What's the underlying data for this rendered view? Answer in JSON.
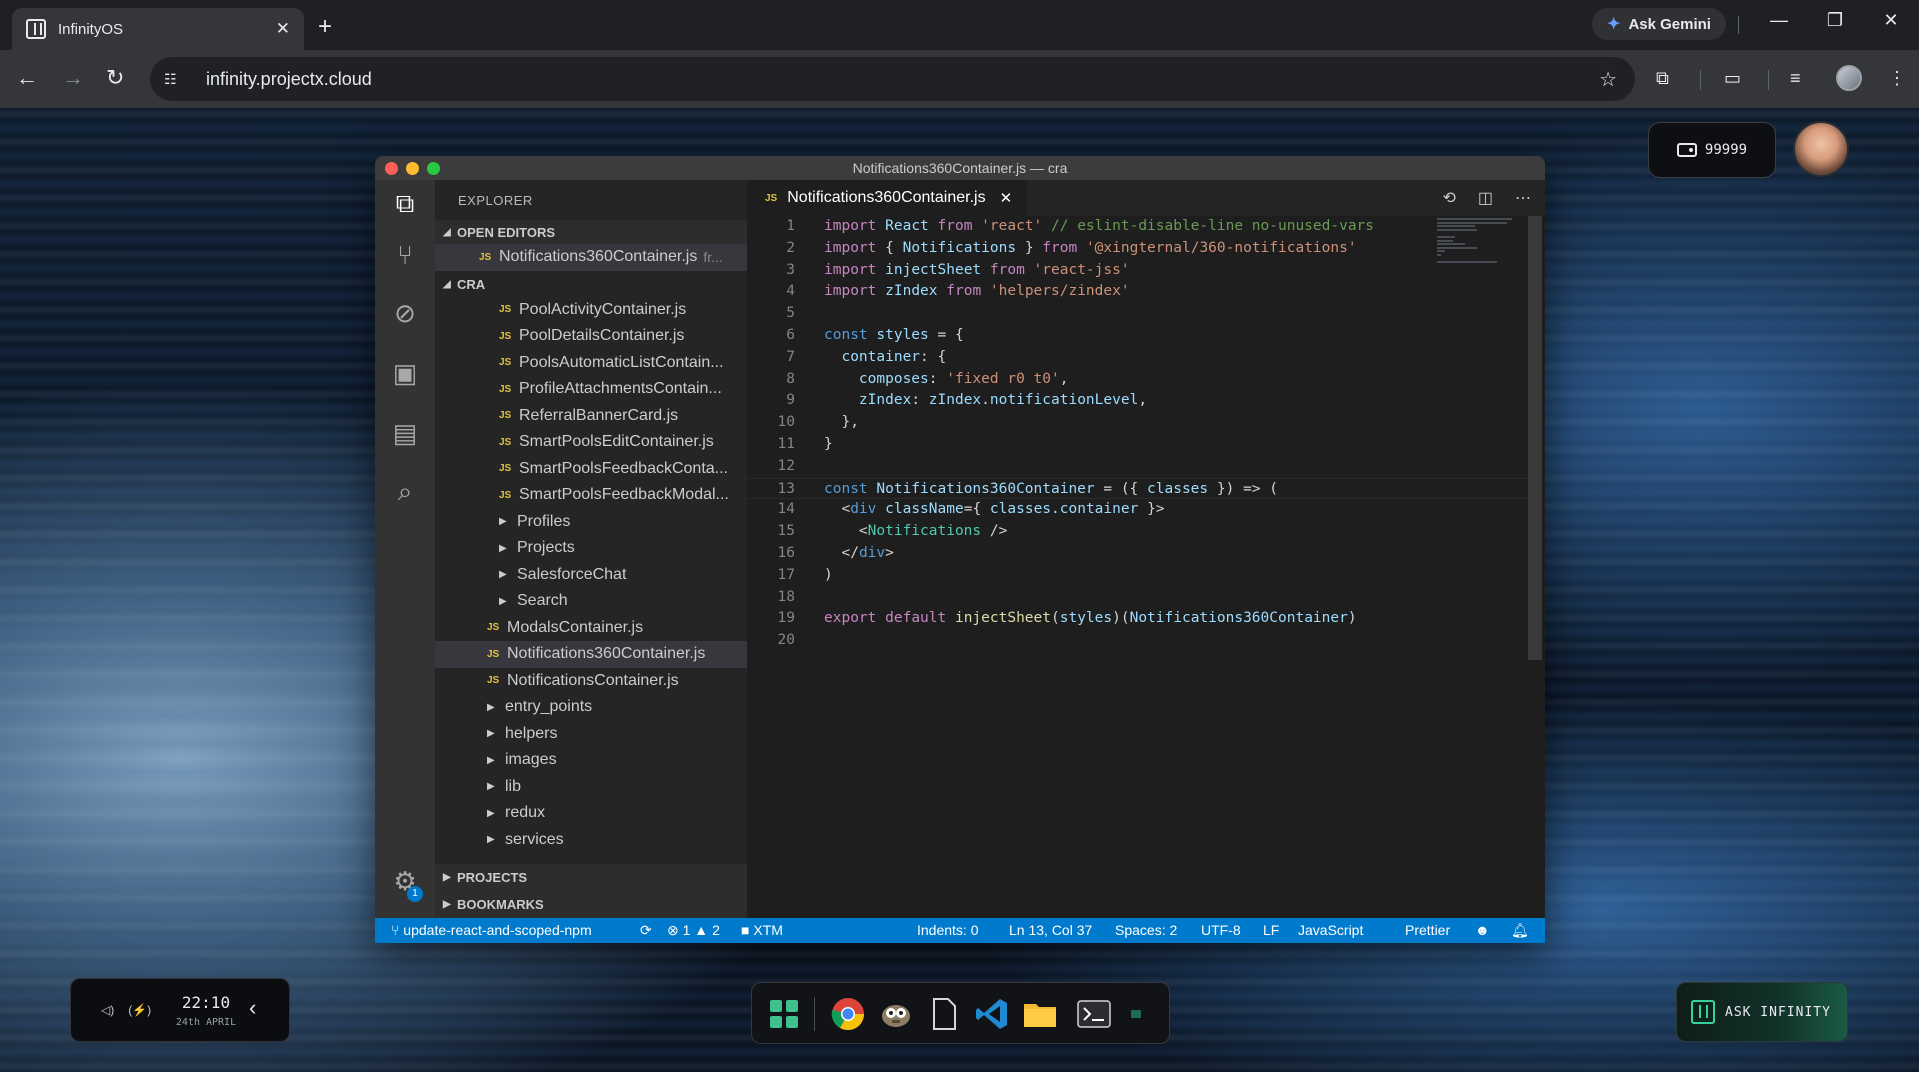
{
  "browser": {
    "tab_title": "InfinityOS",
    "tab_close": "✕",
    "new_tab": "+",
    "url": "infinity.projectx.cloud",
    "gemini_label": "Ask Gemini"
  },
  "desktop": {
    "wallet_value": "99999",
    "clock": {
      "time": "22:10",
      "date": "24th APRIL"
    },
    "ask_infinity_label": "ASK INFINITY"
  },
  "vscode": {
    "window_title": "Notifications360Container.js — cra",
    "explorer_title": "EXPLORER",
    "open_editors_label": "OPEN EDITORS",
    "open_editor_file": "Notifications360Container.js",
    "open_editor_hint": "fr...",
    "cra_label": "CRA",
    "tree": [
      {
        "type": "file",
        "indent": 2,
        "label": "PoolActivityContainer.js"
      },
      {
        "type": "file",
        "indent": 2,
        "label": "PoolDetailsContainer.js"
      },
      {
        "type": "file",
        "indent": 2,
        "label": "PoolsAutomaticListContain..."
      },
      {
        "type": "file",
        "indent": 2,
        "label": "ProfileAttachmentsContain..."
      },
      {
        "type": "file",
        "indent": 2,
        "label": "ReferralBannerCard.js"
      },
      {
        "type": "file",
        "indent": 2,
        "label": "SmartPoolsEditContainer.js"
      },
      {
        "type": "file",
        "indent": 2,
        "label": "SmartPoolsFeedbackConta..."
      },
      {
        "type": "file",
        "indent": 2,
        "label": "SmartPoolsFeedbackModal..."
      },
      {
        "type": "folder",
        "indent": 1,
        "label": "Profiles"
      },
      {
        "type": "folder",
        "indent": 1,
        "label": "Projects"
      },
      {
        "type": "folder",
        "indent": 1,
        "label": "SalesforceChat"
      },
      {
        "type": "folder",
        "indent": 1,
        "label": "Search"
      },
      {
        "type": "file",
        "indent": 1,
        "label": "ModalsContainer.js"
      },
      {
        "type": "file",
        "indent": 1,
        "label": "Notifications360Container.js",
        "selected": true
      },
      {
        "type": "file",
        "indent": 1,
        "label": "NotificationsContainer.js"
      },
      {
        "type": "folder",
        "indent": 0,
        "label": "entry_points"
      },
      {
        "type": "folder",
        "indent": 0,
        "label": "helpers"
      },
      {
        "type": "folder",
        "indent": 0,
        "label": "images"
      },
      {
        "type": "folder",
        "indent": 0,
        "label": "lib"
      },
      {
        "type": "folder",
        "indent": 0,
        "label": "redux"
      },
      {
        "type": "folder",
        "indent": 0,
        "label": "services"
      }
    ],
    "projects_label": "PROJECTS",
    "bookmarks_label": "BOOKMARKS",
    "settings_badge": "1",
    "editor_tab": "Notifications360Container.js",
    "code_lines": [
      "import React from 'react' // eslint-disable-line no-unused-vars",
      "import { Notifications } from '@xingternal/360-notifications'",
      "import injectSheet from 'react-jss'",
      "import zIndex from 'helpers/zindex'",
      "",
      "const styles = {",
      "  container: {",
      "    composes: 'fixed r0 t0',",
      "    zIndex: zIndex.notificationLevel,",
      "  },",
      "}",
      "",
      "const Notifications360Container = ({ classes }) => (",
      "  <div className={ classes.container }>",
      "    <Notifications />",
      "  </div>",
      ")",
      "",
      "export default injectSheet(styles)(Notifications360Container)",
      ""
    ],
    "status": {
      "branch": "update-react-and-scoped-npm",
      "errors": "1",
      "warnings": "2",
      "folder": "XTM",
      "indents": "Indents: 0",
      "position": "Ln 13, Col 37",
      "spaces": "Spaces: 2",
      "encoding": "UTF-8",
      "eol": "LF",
      "language": "JavaScript",
      "formatter": "Prettier"
    }
  },
  "colors": {
    "statusbar": "#007acc",
    "js_icon": "#e2c33f",
    "traffic_red": "#ff5f57",
    "traffic_yellow": "#febc2e",
    "traffic_green": "#28c840"
  }
}
